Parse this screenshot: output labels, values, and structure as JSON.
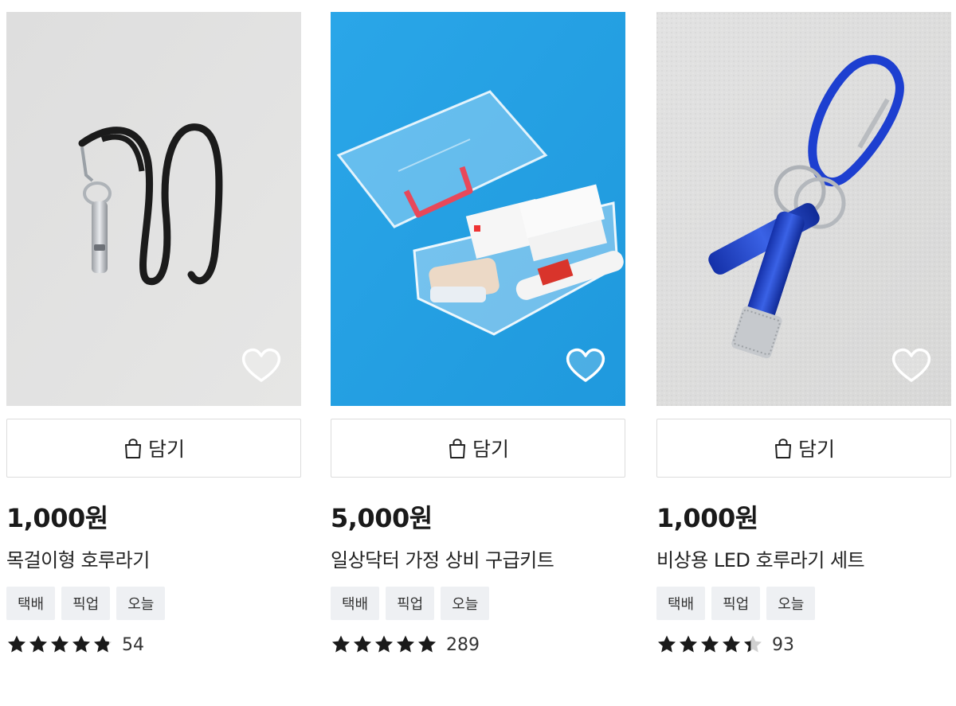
{
  "colors": {
    "tag_bg": "#eef0f3",
    "star": "#1a1a1a",
    "star_empty": "#d0d0d0",
    "card2_bg": "#2aa6e8"
  },
  "products": [
    {
      "image_icon": "whistle-lanyard-photo",
      "cart_label": "담기",
      "price": "1,000원",
      "name": "목걸이형 호루라기",
      "tags": [
        "택배",
        "픽업",
        "오늘"
      ],
      "rating": 4.8,
      "review_count": "54"
    },
    {
      "image_icon": "first-aid-kit-photo",
      "cart_label": "담기",
      "price": "5,000원",
      "name": "일상닥터 가정 상비 구급키트",
      "tags": [
        "택배",
        "픽업",
        "오늘"
      ],
      "rating": 5.0,
      "review_count": "289"
    },
    {
      "image_icon": "led-whistle-set-photo",
      "cart_label": "담기",
      "price": "1,000원",
      "name": "비상용 LED 호루라기 세트",
      "tags": [
        "택배",
        "픽업",
        "오늘"
      ],
      "rating": 4.4,
      "review_count": "93"
    }
  ]
}
